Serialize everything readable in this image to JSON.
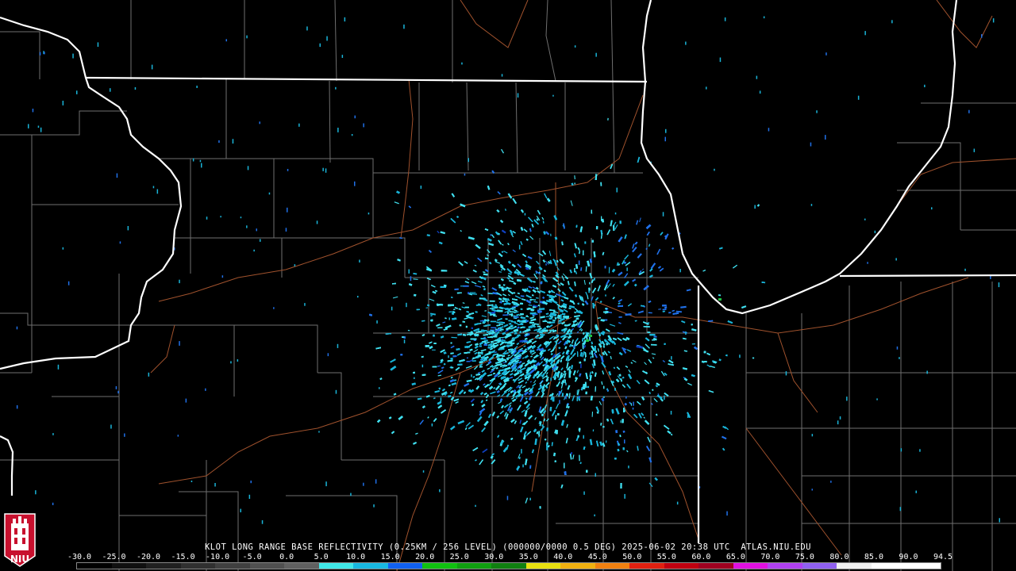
{
  "map": {
    "caption": "KLOT LONG RANGE BASE REFLECTIVITY (0.25KM / 256 LEVEL) (000000/0000 0.5 DEG) 2025-06-02 20:38 UTC  ATLAS.NIU.EDU",
    "background_color": "#000000",
    "county_line_color": "#6f6f6f",
    "highway_color": "#a0522d",
    "state_line_color": "#ffffff",
    "echo_colors": [
      "#40e0f0",
      "#19b4d8",
      "#2070e8",
      "#1040c0",
      "#20c040"
    ]
  },
  "legend": {
    "labels": [
      "-30.0",
      "-25.0",
      "-20.0",
      "-15.0",
      "-10.0",
      "-5.0",
      "0.0",
      "5.0",
      "10.0",
      "15.0",
      "20.0",
      "25.0",
      "30.0",
      "35.0",
      "40.0",
      "45.0",
      "50.0",
      "55.0",
      "60.0",
      "65.0",
      "70.0",
      "75.0",
      "80.0",
      "85.0",
      "90.0",
      "94.5"
    ],
    "colors": [
      "#000000",
      "#101010",
      "#202020",
      "#303030",
      "#404040",
      "#505050",
      "#606060",
      "#40e8e8",
      "#18b8e0",
      "#1060f0",
      "#10c010",
      "#10a010",
      "#108010",
      "#e8e010",
      "#f0b010",
      "#f08010",
      "#e02010",
      "#c00010",
      "#a00020",
      "#e010e0",
      "#b040f0",
      "#9060f0",
      "#f0f0f0",
      "#ffffff",
      "#ffffff"
    ]
  },
  "logo": {
    "text": "NIU"
  }
}
